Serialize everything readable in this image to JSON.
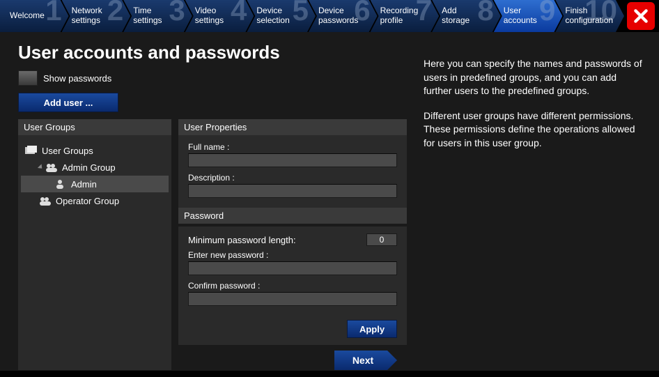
{
  "steps": [
    {
      "num": "1",
      "label": "Welcome"
    },
    {
      "num": "2",
      "label": "Network\nsettings"
    },
    {
      "num": "3",
      "label": "Time\nsettings"
    },
    {
      "num": "4",
      "label": "Video\nsettings"
    },
    {
      "num": "5",
      "label": "Device\nselection"
    },
    {
      "num": "6",
      "label": "Device\npasswords"
    },
    {
      "num": "7",
      "label": "Recording\nprofile"
    },
    {
      "num": "8",
      "label": "Add\nstorage"
    },
    {
      "num": "9",
      "label": "User\naccounts"
    },
    {
      "num": "10",
      "label": "Finish\nconfiguration"
    }
  ],
  "active_step": 8,
  "title": "User accounts and passwords",
  "show_passwords_label": "Show passwords",
  "add_user_label": "Add user ...",
  "groups_header": "User Groups",
  "props_header": "User Properties",
  "password_header": "Password",
  "tree": {
    "root": "User Groups",
    "items": [
      {
        "label": "Admin Group",
        "children": [
          {
            "label": "Admin",
            "selected": true
          }
        ]
      },
      {
        "label": "Operator Group",
        "children": []
      }
    ]
  },
  "props": {
    "full_name_label": "Full name :",
    "full_name_value": "",
    "description_label": "Description :",
    "description_value": "",
    "min_pw_label": "Minimum password length:",
    "min_pw_value": "0",
    "enter_pw_label": "Enter new password :",
    "enter_pw_value": "",
    "confirm_pw_label": "Confirm password :",
    "confirm_pw_value": ""
  },
  "apply_label": "Apply",
  "next_label": "Next",
  "help": {
    "p1": "Here you can specify the names and passwords of users in predefined groups, and you can add further users to the predefined groups.",
    "p2": "Different user groups have different permissions. These permissions define the operations allowed for users in this user group."
  }
}
